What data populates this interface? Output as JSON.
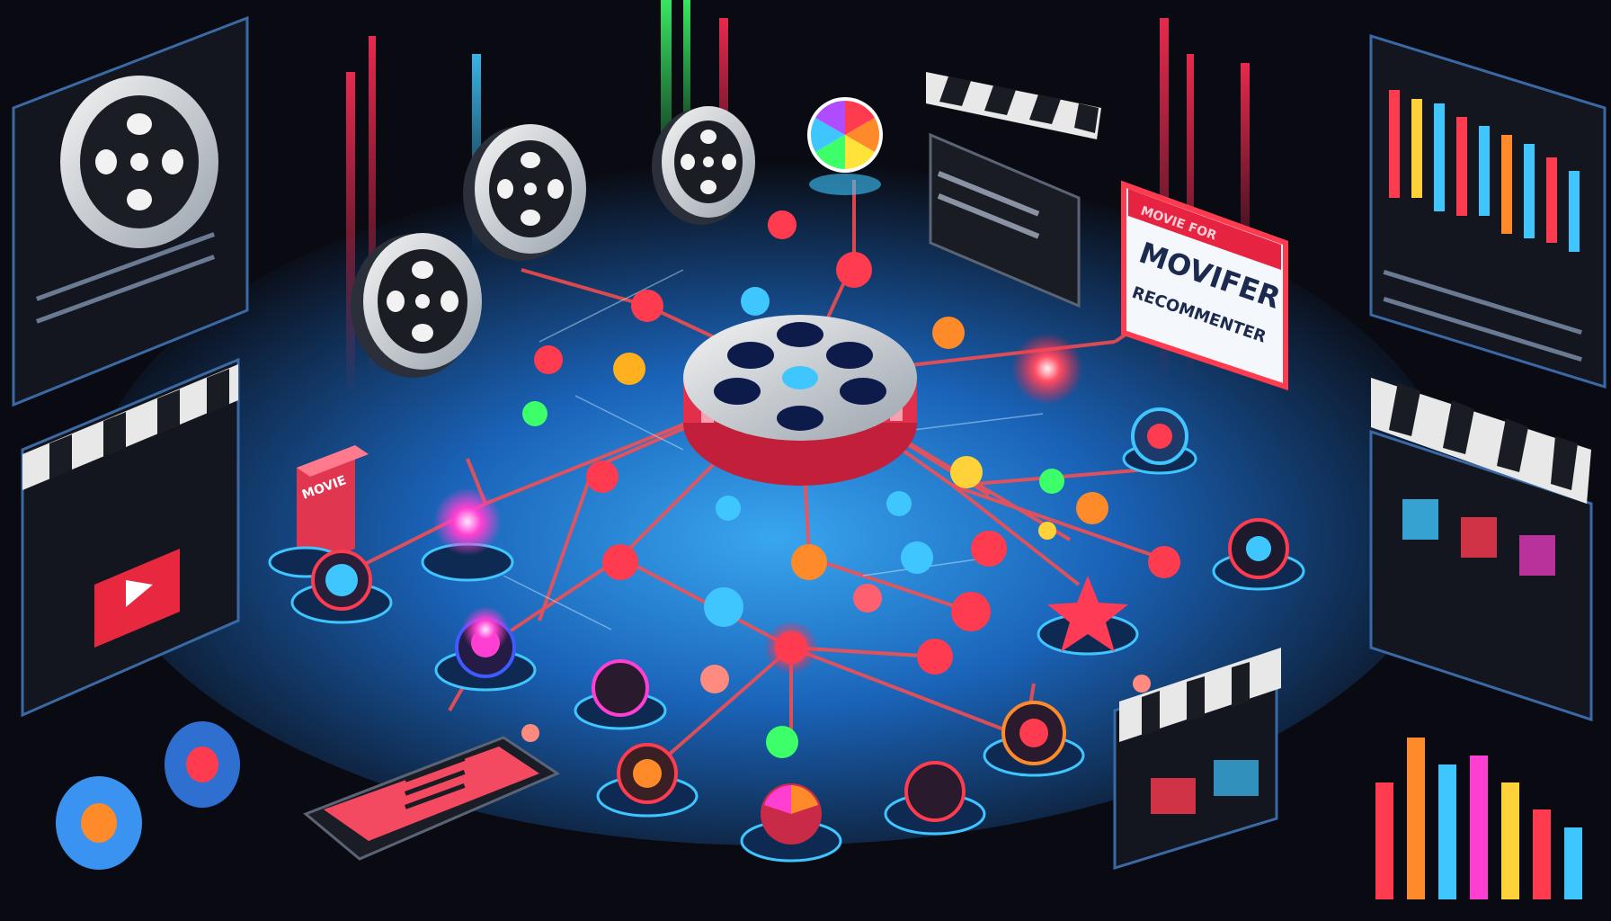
{
  "scene": {
    "movie_box_label": "MOVIE",
    "sign_banner_text": "MOVIE FOR",
    "sign_title": "MOVIFER",
    "sign_subtitle": "RECOMMENTER"
  },
  "colors": {
    "background": "#0a0b12",
    "floor_glow": "#1f7fd6",
    "neon_red": "#ff3b4f",
    "neon_blue": "#3fc6ff",
    "neon_green": "#3dff6a",
    "neon_orange": "#ff8a2a"
  },
  "icons": [
    "film-reel-icon",
    "clapperboard-icon",
    "play-button-icon",
    "color-wheel-icon",
    "bar-chart-icon",
    "star-icon"
  ]
}
